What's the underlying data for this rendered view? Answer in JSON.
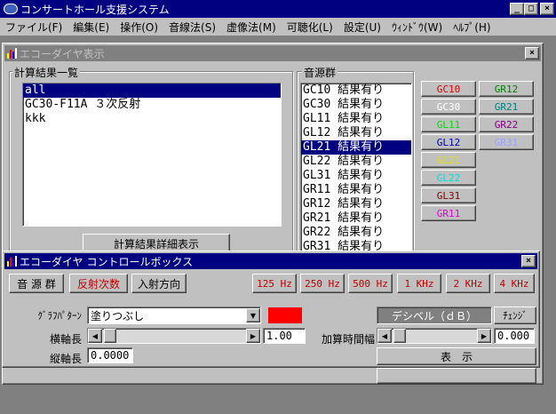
{
  "app": {
    "title": "コンサートホール支援システム",
    "menu": [
      "ファイル(F)",
      "編集(E)",
      "操作(O)",
      "音線法(S)",
      "虚像法(M)",
      "可聴化(L)",
      "設定(U)",
      "ｳｨﾝﾄﾞｳ(W)",
      "ﾍﾙﾌﾟ(H)"
    ]
  },
  "echo_window": {
    "title": "エコーダイヤ表示",
    "results_label": "計算結果一覧",
    "results": [
      "all",
      "GC30-F11A ３次反射",
      "kkk"
    ],
    "results_selected": 0,
    "detail_button": "計算結果詳細表示",
    "sources_label": "音源群",
    "sources": [
      "GC10 結果有り",
      "GC30 結果有り",
      "GL11 結果有り",
      "GL12 結果有り",
      "GL21 結果有り",
      "GL22 結果有り",
      "GL31 結果有り",
      "GR11 結果有り",
      "GR12 結果有り",
      "GR21 結果有り",
      "GR22 結果有り",
      "GR31 結果有り"
    ],
    "sources_selected": 4,
    "group_buttons_left": [
      {
        "label": "GC10",
        "color": "#e00000"
      },
      {
        "label": "GC30",
        "color": "#ffffff"
      },
      {
        "label": "GL11",
        "color": "#00e000"
      },
      {
        "label": "GL12",
        "color": "#0000c0"
      },
      {
        "label": "GL21",
        "color": "#e0e000"
      },
      {
        "label": "GL22",
        "color": "#00e0e0"
      },
      {
        "label": "GL31",
        "color": "#800000"
      },
      {
        "label": "GR11",
        "color": "#e000e0"
      }
    ],
    "group_buttons_right": [
      {
        "label": "GR12",
        "color": "#008000"
      },
      {
        "label": "GR21",
        "color": "#008080"
      },
      {
        "label": "GR22",
        "color": "#800080"
      },
      {
        "label": "GR31",
        "color": "#a0a0ff"
      }
    ]
  },
  "control_box": {
    "title": "エコーダイヤ コントロールボックス",
    "mode_buttons": [
      "音 源 群",
      "反射次数",
      "入射方向"
    ],
    "mode_colors": [
      "#000000",
      "#c00000",
      "#000000"
    ],
    "freq_buttons": [
      "125 Hz",
      "250 Hz",
      "500 Hz",
      "1 KHz",
      "2 KHz",
      "4 KHz"
    ],
    "graph_pattern_label": "ｸﾞﾗﾌﾊﾟﾀｰﾝ",
    "graph_pattern_value": "塗りつぶし",
    "color_swatch": "#ff0000",
    "x_axis_label": "横軸長",
    "x_axis_value": "1.00",
    "y_axis_label": "縦軸長",
    "y_axis_value": "0.0000",
    "decibel_label": "デシベル（ｄＢ）",
    "change_label": "ﾁｪﾝｼﾞ",
    "add_time_label": "加算時間幅",
    "add_time_value": "0.000",
    "display_button": "表　示"
  }
}
